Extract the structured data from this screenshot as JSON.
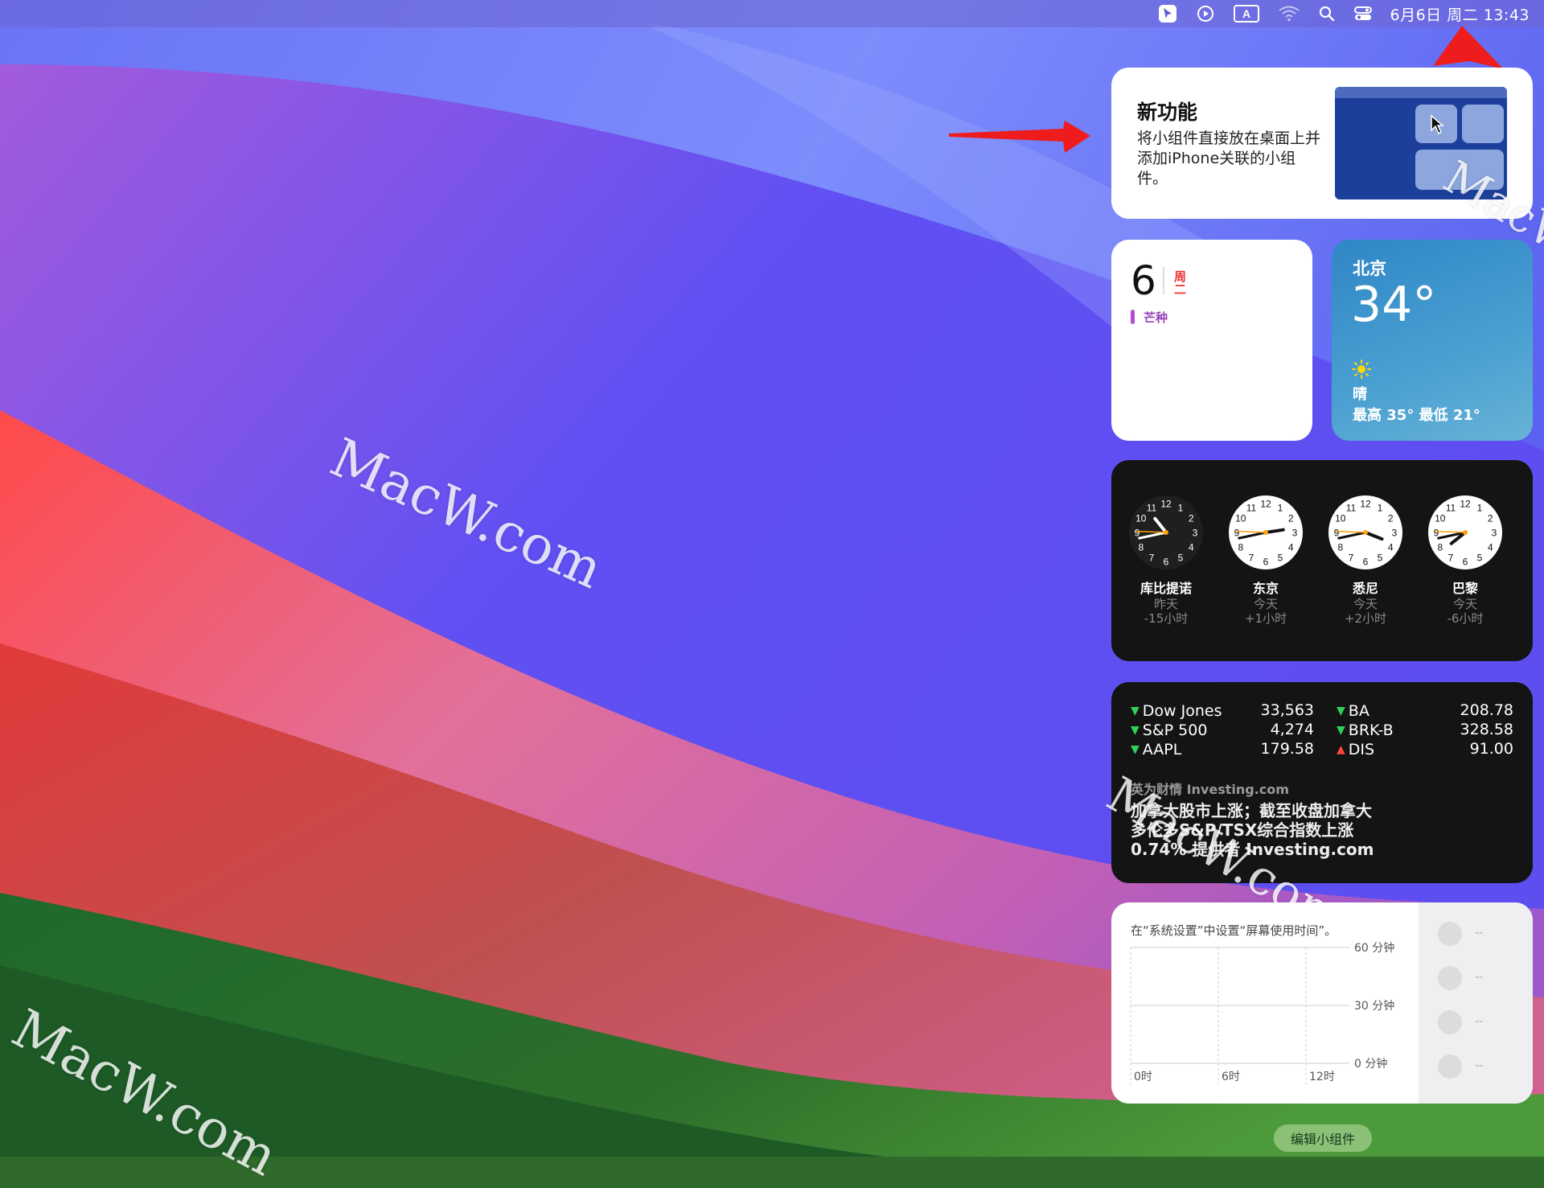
{
  "menubar": {
    "icons": [
      "cursor-app-icon",
      "play-circle-icon",
      "input-source-a-icon",
      "wifi-icon",
      "search-icon",
      "control-center-icon"
    ],
    "input_source": "A",
    "datetime": "6月6日 周二 13:43"
  },
  "watermarks": [
    "MacW.com",
    "MacW.com",
    "MacW.com",
    "MacW.com"
  ],
  "new_feature": {
    "title": "新功能",
    "body": "将小组件直接放在桌面上并添加iPhone关联的小组件。"
  },
  "calendar": {
    "day": "6",
    "weekday": "周二",
    "event": "芒种"
  },
  "weather": {
    "city": "北京",
    "temp": "34°",
    "condition": "晴",
    "hilo": "最高 35° 最低 21°",
    "icon": "sun-icon"
  },
  "world_clock": {
    "clocks": [
      {
        "city": "库比提诺",
        "day": "昨天",
        "offset": "-15小时",
        "dark": true,
        "hour": 10,
        "minute": 43
      },
      {
        "city": "东京",
        "day": "今天",
        "offset": "+1小时",
        "dark": false,
        "hour": 14,
        "minute": 43
      },
      {
        "city": "悉尼",
        "day": "今天",
        "offset": "+2小时",
        "dark": false,
        "hour": 15,
        "minute": 43
      },
      {
        "city": "巴黎",
        "day": "今天",
        "offset": "-6小时",
        "dark": false,
        "hour": 7,
        "minute": 43
      }
    ]
  },
  "stocks": {
    "left": [
      {
        "name": "Dow Jones",
        "value": "33,563",
        "dir": "down"
      },
      {
        "name": "S&P 500",
        "value": "4,274",
        "dir": "down"
      },
      {
        "name": "AAPL",
        "value": "179.58",
        "dir": "down"
      }
    ],
    "right": [
      {
        "name": "BA",
        "value": "208.78",
        "dir": "down"
      },
      {
        "name": "BRK-B",
        "value": "328.58",
        "dir": "down"
      },
      {
        "name": "DIS",
        "value": "91.00",
        "dir": "up"
      }
    ],
    "news_source": "英为财情 Investing.com",
    "news_lines": [
      "加拿大股市上涨；截至收盘加拿大",
      "多伦多S&P/TSX综合指数上涨",
      "0.74% 提供者 Investing.com"
    ],
    "up_color": "#ff453a",
    "down_color": "#2fd158"
  },
  "screen_time": {
    "note": "在“系统设置”中设置“屏幕使用时间”。",
    "y_labels": [
      "60 分钟",
      "30 分钟",
      "0 分钟"
    ],
    "x_labels": [
      "0时",
      "6时",
      "12时"
    ],
    "placeholders": [
      "--",
      "--",
      "--",
      "--"
    ]
  },
  "edit_button": "编辑小组件",
  "colors": {
    "annotation_arrow": "#ee1c1c"
  }
}
